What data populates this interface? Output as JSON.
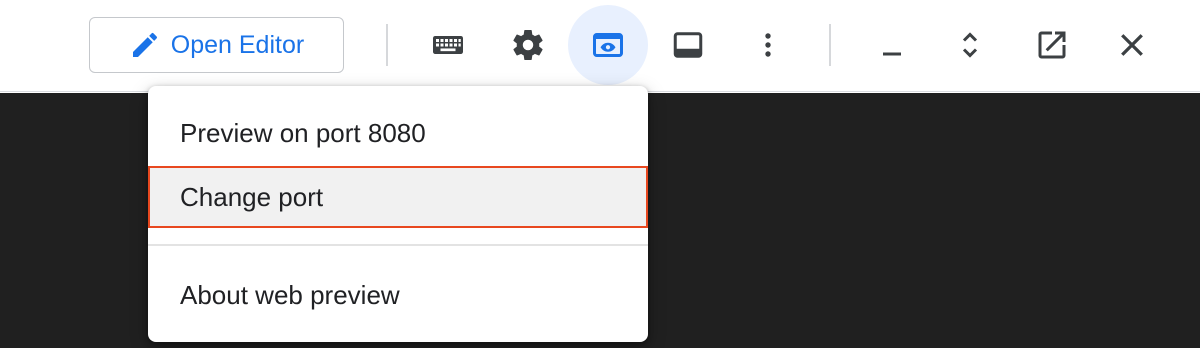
{
  "toolbar": {
    "open_editor_label": "Open Editor",
    "buttons": [
      "keyboard-icon",
      "settings-icon",
      "web-preview-icon",
      "toggle-panel-icon",
      "more-options-icon",
      "minimize-icon",
      "maximize-icon",
      "open-new-window-icon",
      "close-icon"
    ],
    "active_button": "web-preview-icon"
  },
  "menu": {
    "items": [
      {
        "label": "Preview on port 8080"
      },
      {
        "label": "Change port",
        "highlighted": true
      },
      {
        "label": "About web preview"
      }
    ]
  },
  "colors": {
    "accent": "#1a73e8",
    "active_bg": "#e8f0fe",
    "highlight_border": "#e8481f",
    "terminal_bg": "#202020"
  }
}
